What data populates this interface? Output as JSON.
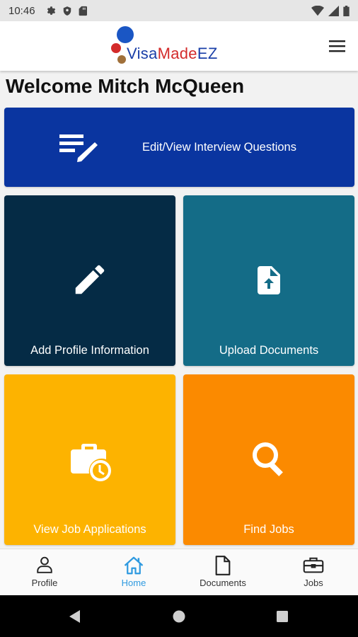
{
  "status_bar": {
    "time": "10:46"
  },
  "header": {
    "logo_parts": [
      "Visa",
      "Made",
      "EZ"
    ],
    "colors": {
      "blue": "#1a3fa8",
      "red": "#d32b2b",
      "brown": "#a0703a",
      "circle_blue": "#1a56c4"
    }
  },
  "welcome": "Welcome Mitch McQueen",
  "tiles": [
    {
      "label": "Edit/View Interview Questions",
      "icon": "edit-notes-icon",
      "color": "#0a35a0"
    },
    {
      "label": "Add Profile Information",
      "icon": "pencil-icon",
      "color": "#052b45"
    },
    {
      "label": "Upload Documents",
      "icon": "upload-file-icon",
      "color": "#146c87"
    },
    {
      "label": "View Job Applications",
      "icon": "work-history-icon",
      "color": "#fdb300"
    },
    {
      "label": "Find Jobs",
      "icon": "search-icon",
      "color": "#fb8a00"
    }
  ],
  "bottom_nav": [
    {
      "label": "Profile",
      "icon": "person-icon",
      "active": false
    },
    {
      "label": "Home",
      "icon": "home-icon",
      "active": true
    },
    {
      "label": "Documents",
      "icon": "document-icon",
      "active": false
    },
    {
      "label": "Jobs",
      "icon": "briefcase-icon",
      "active": false
    }
  ],
  "accent_color": "#2f9ae0"
}
